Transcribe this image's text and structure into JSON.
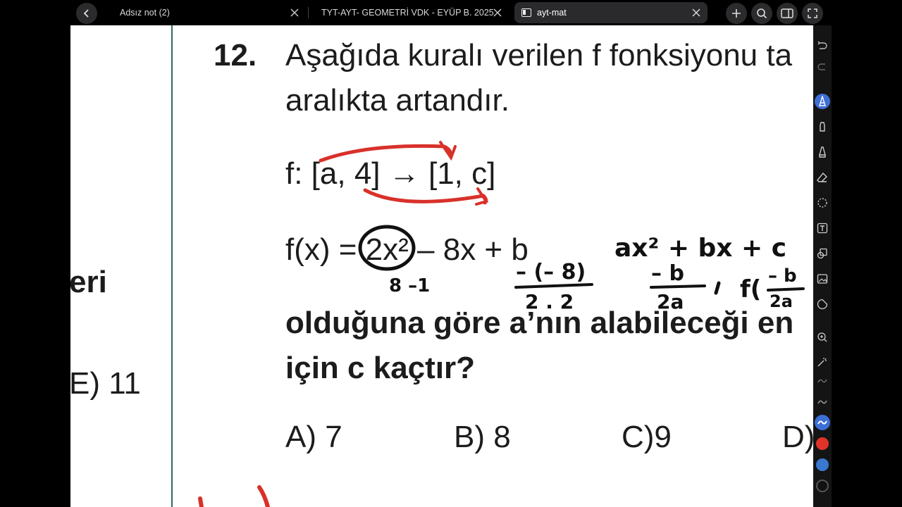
{
  "tabs": [
    {
      "label": "Adsız not (2)"
    },
    {
      "label": "TYT-AYT- GEOMETRİ VDK - EYÜP B. 2025"
    },
    {
      "label": "ayt-mat"
    }
  ],
  "question": {
    "number": "12.",
    "line1": "Aşağıda kuralı verilen f fonksiyonu ta",
    "line2": "aralıkta artandır.",
    "function_def": "f: [a, 4] → [1, c]",
    "formula": "f(x) = 2x² – 8x + b",
    "prompt_line1": "olduğuna göre a’nın alabileceği en",
    "prompt_line2": "için c kaçtır?",
    "options": [
      "A) 7",
      "B) 8",
      "C)9",
      "D)"
    ]
  },
  "left_fragment": {
    "text1": "eri",
    "text2": "E) 11"
  },
  "handwriting": {
    "n1": "8 –1",
    "vertex_num": "– (– 8)",
    "vertex_den": "2 . 2",
    "general": "ax² + bx + c",
    "b_over_2a_num": "– b",
    "b_over_2a_den": "2a",
    "f_of": "f(",
    "f_num": "– b",
    "f_den": "2a"
  },
  "colors": {
    "ink_red": "#d8312a",
    "ink_black": "#111111",
    "accent": "#3d6fd6",
    "divider": "#2f6f64"
  },
  "toolbar_icons": [
    "undo-icon",
    "redo-icon",
    "pen-icon",
    "marker-icon",
    "highlighter-icon",
    "eraser-icon",
    "lasso-icon",
    "text-icon",
    "shapes-icon",
    "image-icon",
    "sticker-icon",
    "zoom-icon",
    "laser-icon",
    "thin-stroke-icon",
    "medium-stroke-icon",
    "thick-stroke-icon",
    "red-color",
    "blue-color",
    "black-color"
  ]
}
